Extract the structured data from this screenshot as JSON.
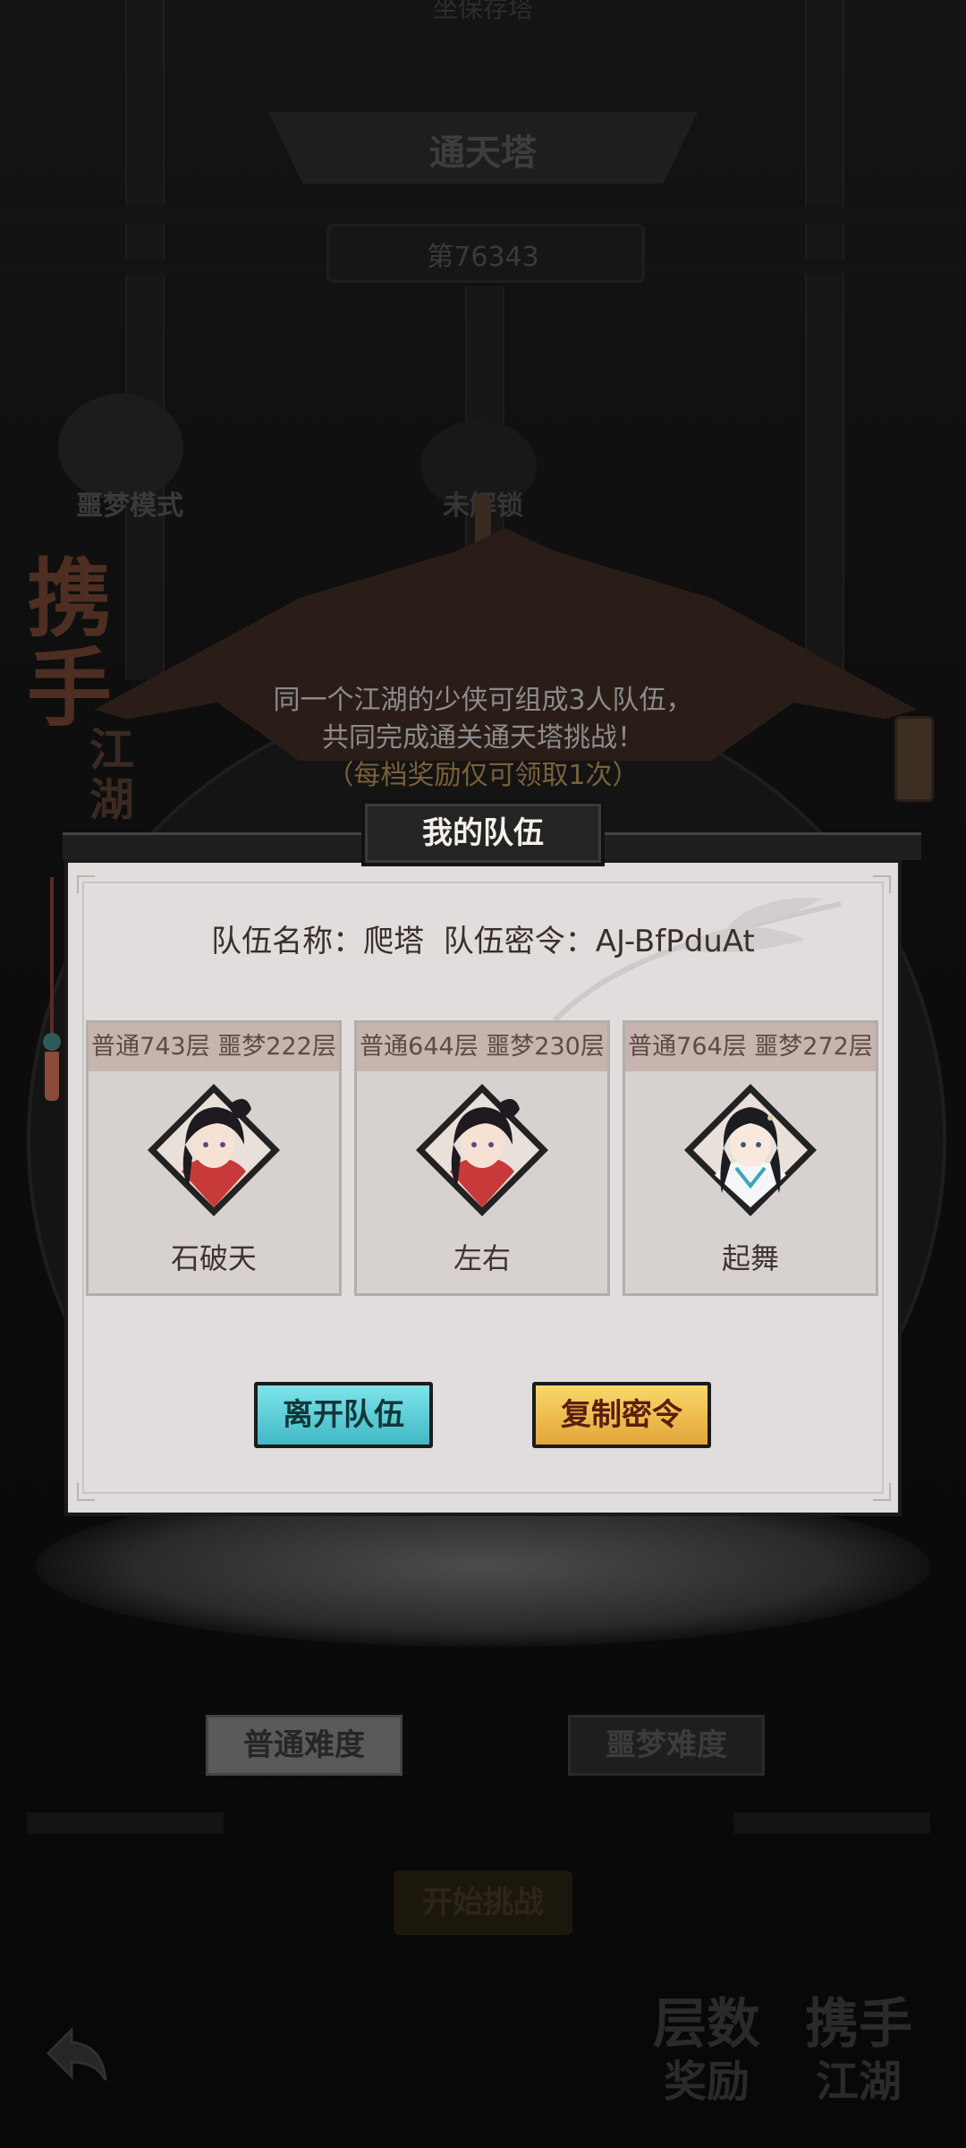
{
  "background": {
    "top_cut_text": "坐保存塔",
    "tower_title": "通天塔",
    "tower_id": "第76343",
    "nightmare_mode_label": "噩梦模式",
    "unlock_label": "未解锁",
    "banner_big": "携手",
    "banner_small": "江湖",
    "intro_line1": "同一个江湖的少侠可组成3人队伍，",
    "intro_line2": "共同完成通关通天塔挑战！",
    "intro_note": "（每档奖励仅可领取1次）",
    "difficulty_normal": "普通难度",
    "difficulty_nightmare": "噩梦难度",
    "start_button": "开始挑战",
    "bottom_tiles": [
      {
        "top": "层数",
        "sub": "奖励"
      },
      {
        "top": "携手",
        "sub": "江湖"
      }
    ]
  },
  "modal": {
    "title": "我的队伍",
    "team_name_label": "队伍名称：",
    "team_name": "爬塔",
    "team_code_label": "队伍密令：",
    "team_code": "AJ-BfPduAt",
    "members": [
      {
        "progress": "普通743层 噩梦222层",
        "name": "石破天",
        "avatar": "male-swordsman-avatar"
      },
      {
        "progress": "普通644层 噩梦230层",
        "name": "左右",
        "avatar": "male-swordsman-avatar"
      },
      {
        "progress": "普通764层 噩梦272层",
        "name": "起舞",
        "avatar": "female-dancer-avatar"
      }
    ],
    "leave_button": "离开队伍",
    "copy_button": "复制密令"
  },
  "colors": {
    "modal_bg": "#e0dddc",
    "leave_button": "#5ccfd9",
    "copy_button": "#f0c050",
    "card_header": "#c7b4ae"
  }
}
